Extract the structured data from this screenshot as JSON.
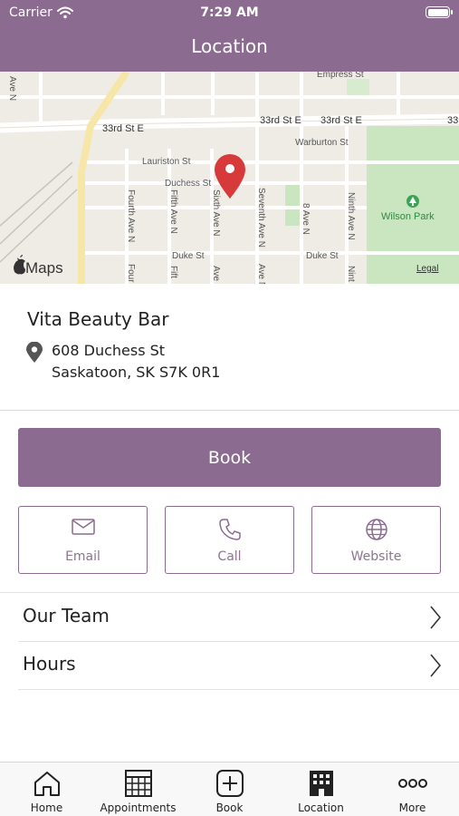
{
  "status_bar": {
    "carrier": "Carrier",
    "time": "7:29 AM"
  },
  "nav": {
    "title": "Location"
  },
  "map": {
    "streets": {
      "empress": "Empress St",
      "33rd_a": "33rd St E",
      "33rd_b": "33rd St E",
      "33rd_c": "33rd St E",
      "33rd_d": "33",
      "warburton": "Warburton St",
      "lauriston": "Lauriston St",
      "duchess": "Duchess St",
      "duke_a": "Duke St",
      "duke_b": "Duke St",
      "fourth": "Fourth Ave N",
      "fourth_b": "Four",
      "fifth": "Fifth Ave N",
      "fifth_b": "Fift",
      "sixth": "Sixth Ave N",
      "seventh": "Seventh Ave N",
      "eighth": "8 Ave N",
      "ninth": "Ninth Ave N",
      "ninth_b": "Nint",
      "ave_n": "Ave N"
    },
    "park": "Wilson Park",
    "maps_logo": "Maps",
    "legal": "Legal"
  },
  "business": {
    "name": "Vita Beauty Bar",
    "address_line1": "608 Duchess St",
    "address_line2": "Saskatoon, SK S7K 0R1"
  },
  "book_button": "Book",
  "actions": {
    "email": "Email",
    "call": "Call",
    "website": "Website"
  },
  "rows": {
    "team": "Our Team",
    "hours": "Hours"
  },
  "tabs": {
    "home": "Home",
    "appointments": "Appointments",
    "book": "Book",
    "location": "Location",
    "more": "More"
  },
  "colors": {
    "brand": "#8c6b90",
    "pin": "#d63a3a",
    "park": "#c9e6c0"
  }
}
